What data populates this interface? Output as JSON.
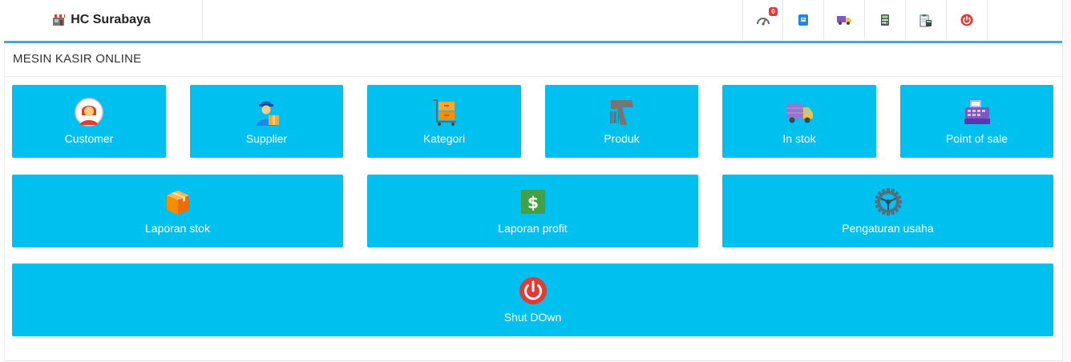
{
  "brand": {
    "name": "HC Surabaya",
    "icon": "store-icon"
  },
  "nav": {
    "items": [
      {
        "icon": "speedometer-icon",
        "badge": "0"
      },
      {
        "icon": "address-book-icon"
      },
      {
        "icon": "delivery-truck-icon"
      },
      {
        "icon": "calculator-icon"
      },
      {
        "icon": "clipboard-calculator-icon"
      },
      {
        "icon": "power-icon"
      }
    ]
  },
  "panel": {
    "title": "MESIN KASIR ONLINE"
  },
  "tiles": {
    "customer": {
      "label": "Customer",
      "icon": "customer-icon"
    },
    "supplier": {
      "label": "Supplier",
      "icon": "supplier-icon"
    },
    "kategori": {
      "label": "Kategori",
      "icon": "boxes-cart-icon"
    },
    "produk": {
      "label": "Produk",
      "icon": "barcode-scanner-icon"
    },
    "instok": {
      "label": "In stok",
      "icon": "truck-icon"
    },
    "pos": {
      "label": "Point of sale",
      "icon": "cash-register-icon"
    },
    "laporan_stok": {
      "label": "Laporan stok",
      "icon": "box-icon"
    },
    "laporan_profit": {
      "label": "Laporan profit",
      "icon": "dollar-icon"
    },
    "pengaturan": {
      "label": "Pengaturan usaha",
      "icon": "gear-icon"
    },
    "shutdown": {
      "label": "Shut DOwn",
      "icon": "power-icon"
    }
  },
  "colors": {
    "tile": "#00c0ef",
    "accent_line": "#3fa9e0",
    "badge": "#e53935"
  }
}
